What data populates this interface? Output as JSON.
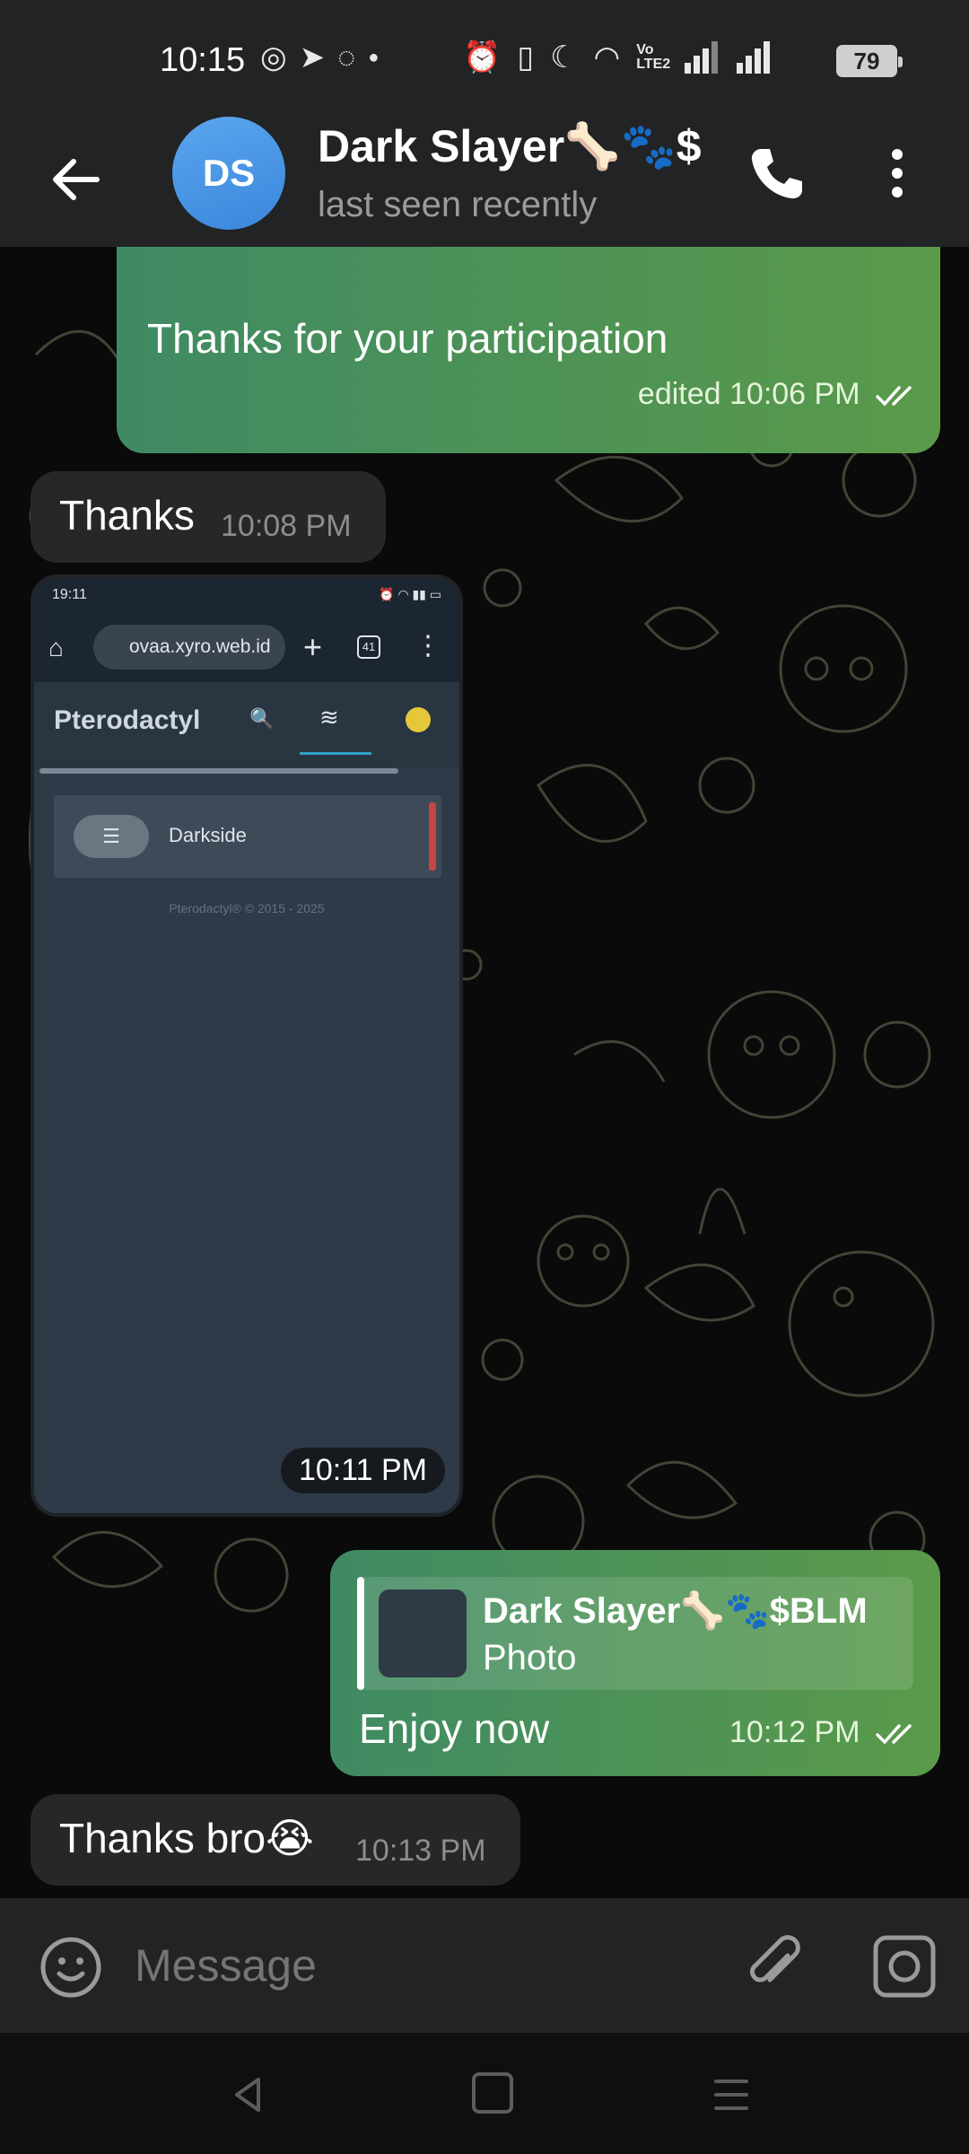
{
  "status_bar": {
    "time": "10:15",
    "battery": "79",
    "volte": "Vo LTE2"
  },
  "header": {
    "avatar_initials": "DS",
    "contact_name": "Dark Slayer🦴🐾$",
    "contact_status": "last seen recently"
  },
  "messages": [
    {
      "direction": "out",
      "text": "Thanks for your participation",
      "meta": "edited 10:06 PM",
      "read": true
    },
    {
      "direction": "in",
      "text": "Thanks",
      "meta": "10:08 PM"
    },
    {
      "direction": "in",
      "type": "photo",
      "meta": "10:11 PM",
      "photo_content": {
        "time": "19:11",
        "url": "ovaa.xyro.web.id",
        "tab_count": "41",
        "brand": "Pterodactyl",
        "server_name": "Darkside",
        "footer": "Pterodactyl® © 2015 - 2025"
      }
    },
    {
      "direction": "out",
      "reply_to": {
        "name": "Dark Slayer🦴🐾$BLM",
        "type": "Photo"
      },
      "text": "Enjoy now",
      "meta": "10:12 PM",
      "read": true
    },
    {
      "direction": "in",
      "text": "Thanks bro😭",
      "meta": "10:13 PM"
    }
  ],
  "composer": {
    "placeholder": "Message"
  },
  "colors": {
    "outgoing_start": "#3f8a63",
    "outgoing_end": "#5a9a4a",
    "incoming": "#262728",
    "header": "#222324",
    "avatar": "#4a96e4"
  }
}
